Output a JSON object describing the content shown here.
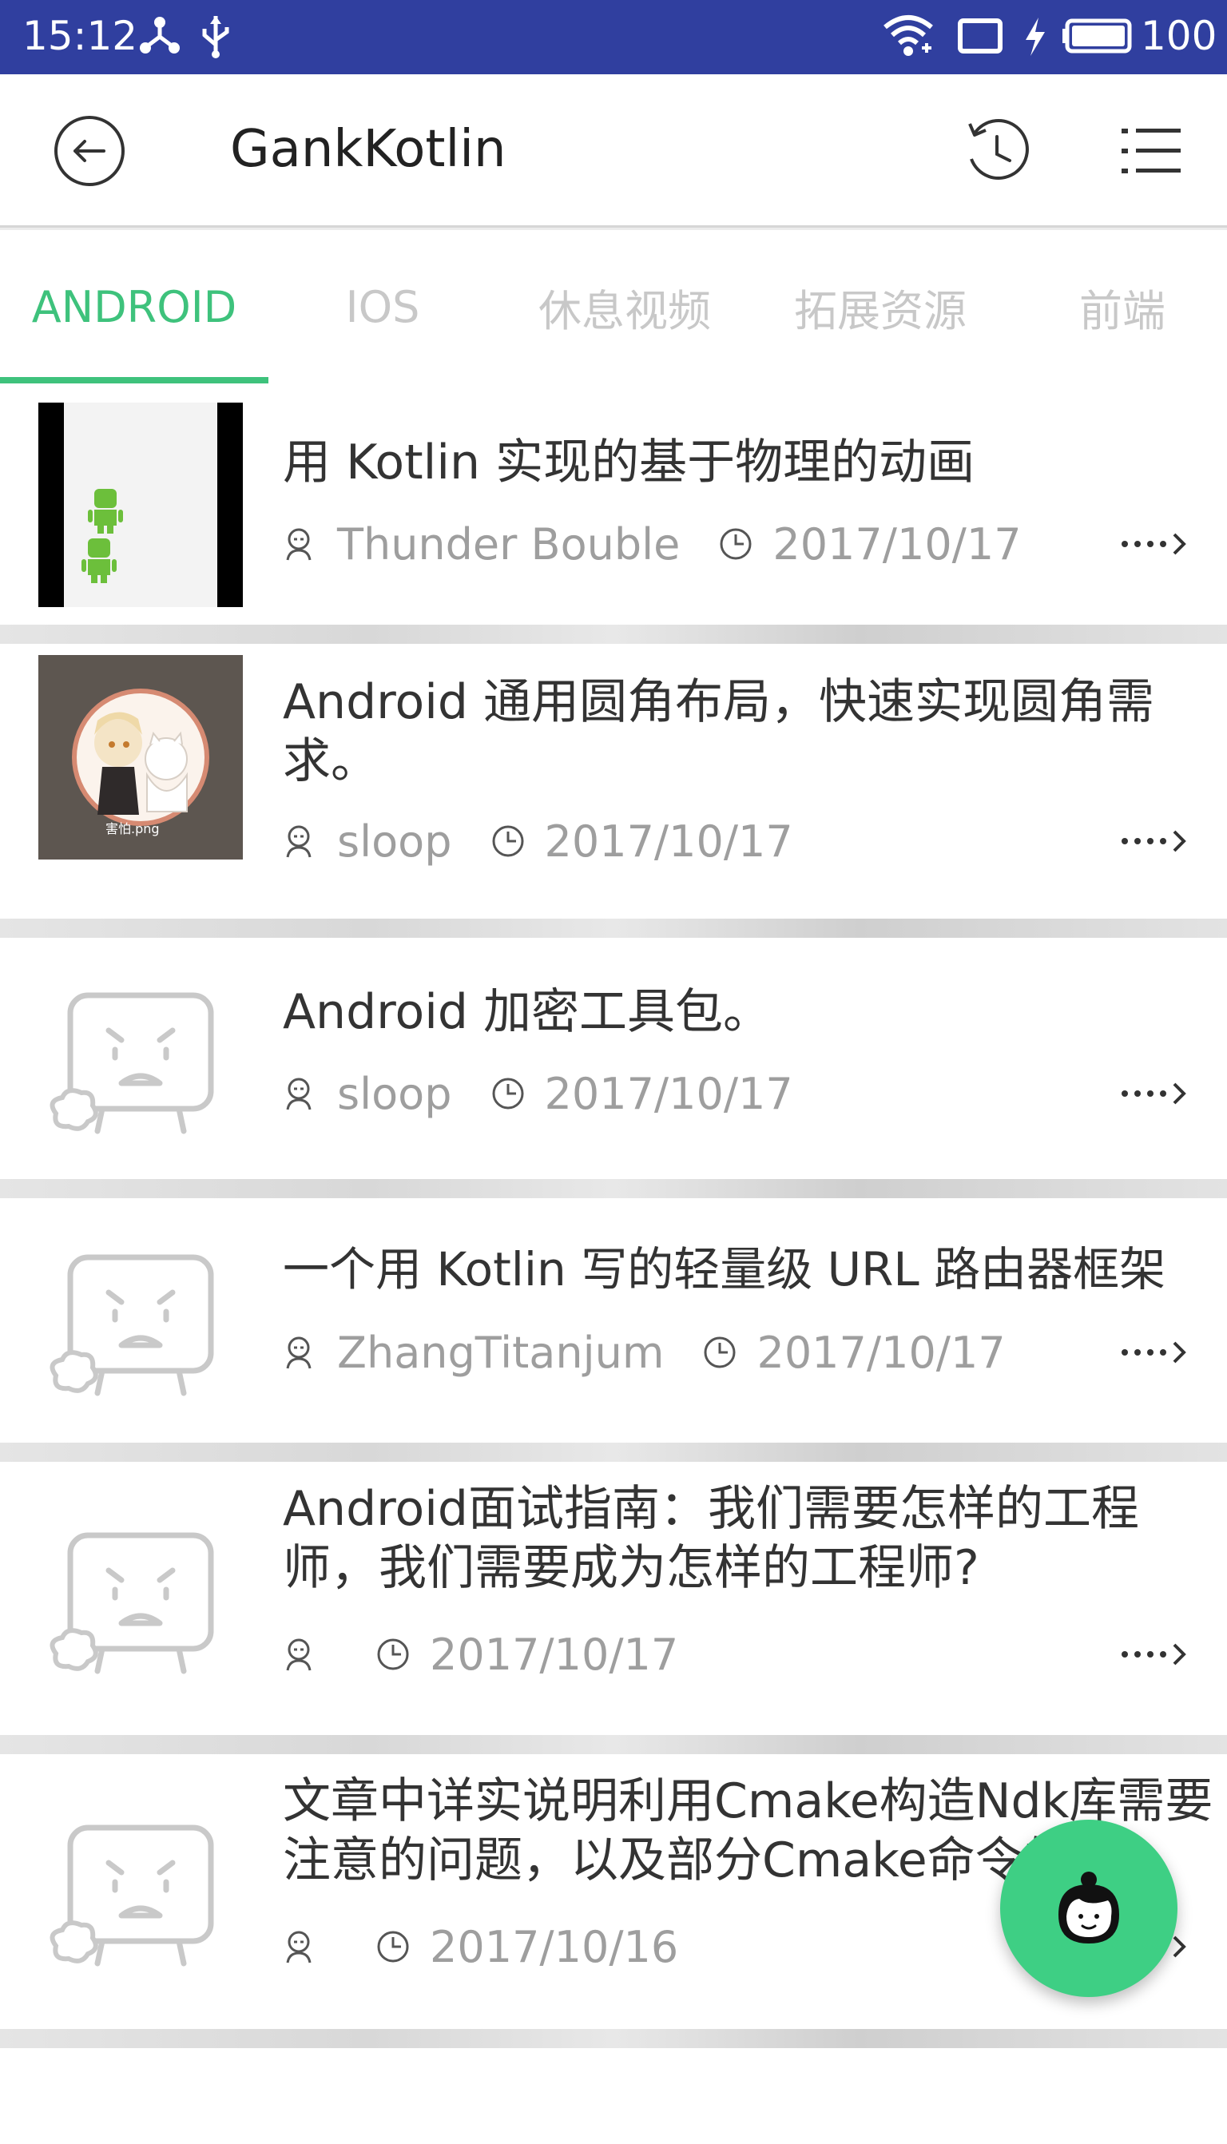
{
  "status_bar": {
    "time": "15:12",
    "battery": "100",
    "icons": [
      "usb-share-icon",
      "usb-icon",
      "wifi-icon",
      "screen-cast-icon",
      "charging-icon",
      "battery-icon"
    ]
  },
  "app_bar": {
    "title": "GankKotlin",
    "icons": [
      "back-icon",
      "history-icon",
      "menu-icon"
    ]
  },
  "tabs": [
    {
      "label": "ANDROID",
      "active": true
    },
    {
      "label": "IOS",
      "active": false
    },
    {
      "label": "休息视频",
      "active": false
    },
    {
      "label": "拓展资源",
      "active": false
    },
    {
      "label": "前端",
      "active": false
    }
  ],
  "colors": {
    "status_bar": "#303f9f",
    "accent": "#3ec27c",
    "fab": "#3ecf84"
  },
  "articles": [
    {
      "title": "用 Kotlin 实现的基于物理的动画",
      "author": "Thunder Bouble",
      "date": "2017/10/17",
      "thumb": "android-robots-preview"
    },
    {
      "title": "Android 通用圆角布局，快速实现圆角需求。",
      "author": "sloop",
      "date": "2017/10/17",
      "thumb": "anime-girl-with-cat",
      "thumb_caption": "害怕.png"
    },
    {
      "title": "Android 加密工具包。",
      "author": "sloop",
      "date": "2017/10/17",
      "thumb": "sad-placeholder"
    },
    {
      "title": "一个用 Kotlin 写的轻量级 URL 路由器框架",
      "author": "ZhangTitanjum",
      "date": "2017/10/17",
      "thumb": "sad-placeholder"
    },
    {
      "title": "Android面试指南：我们需要怎样的工程师，我们需要成为怎样的工程师?",
      "author": "",
      "date": "2017/10/17",
      "thumb": "sad-placeholder"
    },
    {
      "title": "文章中详实说明利用Cmake构造Ndk库需要注意的问题，以及部分Cmake命令的..",
      "author": "",
      "date": "2017/10/16",
      "thumb": "sad-placeholder"
    }
  ],
  "fab": {
    "icon": "face-avatar-icon"
  }
}
